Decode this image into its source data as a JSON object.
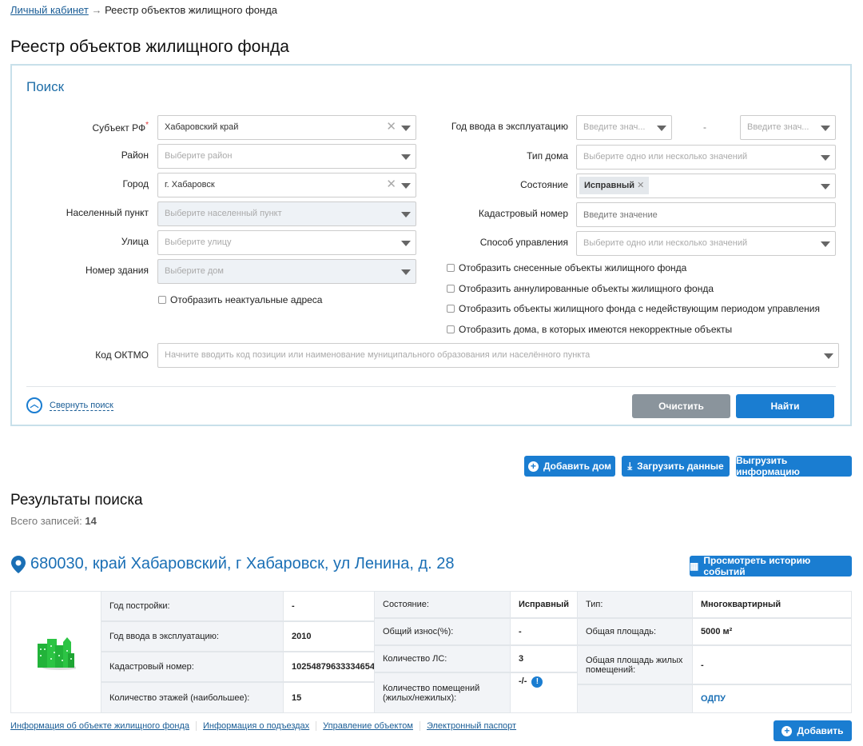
{
  "breadcrumb": {
    "home": "Личный кабинет",
    "sep": "→",
    "current": "Реестр объектов жилищного фонда"
  },
  "page_title": "Реестр объектов жилищного фонда",
  "search": {
    "title": "Поиск",
    "subject": {
      "label": "Субъект РФ",
      "required": "*",
      "value": "Хабаровский край"
    },
    "district": {
      "label": "Район",
      "placeholder": "Выберите район"
    },
    "city": {
      "label": "Город",
      "value": "г. Хабаровск"
    },
    "settlement": {
      "label": "Населенный пункт",
      "placeholder": "Выберите населенный пункт"
    },
    "street": {
      "label": "Улица",
      "placeholder": "Выберите улицу"
    },
    "building": {
      "label": "Номер здания",
      "placeholder": "Выберите дом"
    },
    "show_irrelevant": "Отобразить неактуальные адреса",
    "year": {
      "label": "Год ввода в эксплуатацию",
      "from_placeholder": "Введите знач...",
      "dash": "-",
      "to_placeholder": "Введите знач..."
    },
    "house_type": {
      "label": "Тип дома",
      "placeholder": "Выберите одно или несколько значений"
    },
    "state": {
      "label": "Состояние",
      "tag": "Исправный"
    },
    "cadastral": {
      "label": "Кадастровый номер",
      "placeholder": "Введите значение"
    },
    "management": {
      "label": "Способ управления",
      "placeholder": "Выберите одно или несколько значений"
    },
    "checkboxes": [
      "Отобразить снесенные объекты жилищного фонда",
      "Отобразить аннулированные объекты жилищного фонда",
      "Отобразить объекты жилищного фонда с недействующим периодом управления",
      "Отобразить дома, в которых имеются некорректные объекты"
    ],
    "oktmo": {
      "label": "Код ОКТМО",
      "placeholder": "Начните вводить код позиции или наименование муниципального образования или населённого пункта"
    },
    "collapse": "Свернуть поиск",
    "clear": "Очистить",
    "find": "Найти"
  },
  "actions": {
    "add_house": "Добавить дом",
    "upload": "Загрузить данные",
    "export": "Выгрузить информацию"
  },
  "results": {
    "title": "Результаты поиска",
    "count_label": "Всего записей:",
    "count": "14"
  },
  "house": {
    "address": "680030, край Хабаровский, г Хабаровск, ул Ленина, д. 28",
    "history_button": "Просмотреть историю событий",
    "col1": [
      [
        "Год постройки:",
        "-"
      ],
      [
        "Год ввода в эксплуатацию:",
        "2010"
      ],
      [
        "Кадастровый номер:",
        "10254879633334654"
      ],
      [
        "Количество этажей (наибольшее):",
        "15"
      ]
    ],
    "col2": [
      [
        "Состояние:",
        "Исправный"
      ],
      [
        "Общий износ(%):",
        "-"
      ],
      [
        "Количество ЛС:",
        "3"
      ],
      [
        "Количество помещений (жилых/нежилых):",
        "-/-"
      ]
    ],
    "col3": [
      [
        "Тип:",
        "Многоквартирный"
      ],
      [
        "Общая площадь:",
        "5000 м²"
      ],
      [
        "Общая площадь жилых помещений:",
        "-"
      ],
      [
        "",
        "ОДПУ"
      ]
    ],
    "links": [
      "Информация об объекте жилищного фонда",
      "Информация о подъездах",
      "Управление объектом",
      "Электронный паспорт"
    ],
    "add_button": "Добавить"
  },
  "colors": {
    "accent": "#1a7dd1",
    "link": "#1a5d96",
    "clear_button": "#8a949c",
    "building_icon": "#22b33a"
  }
}
